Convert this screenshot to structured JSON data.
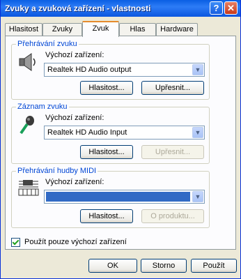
{
  "window": {
    "title": "Zvuky a zvuková zařízení - vlastnosti",
    "help_glyph": "?",
    "close_glyph": "✕"
  },
  "tabs": [
    {
      "label": "Hlasitost"
    },
    {
      "label": "Zvuky"
    },
    {
      "label": "Zvuk",
      "active": true
    },
    {
      "label": "Hlas"
    },
    {
      "label": "Hardware"
    }
  ],
  "playback": {
    "title": "Přehrávání zvuku",
    "device_label": "Výchozí zařízení:",
    "device_value": "Realtek HD Audio output",
    "volume_button": "Hlasitost...",
    "advanced_button": "Upřesnit..."
  },
  "recording": {
    "title": "Záznam zvuku",
    "device_label": "Výchozí zařízení:",
    "device_value": "Realtek HD Audio Input",
    "volume_button": "Hlasitost...",
    "advanced_button": "Upřesnit..."
  },
  "midi": {
    "title": "Přehrávání hudby MIDI",
    "device_label": "Výchozí zařízení:",
    "device_value": "",
    "volume_button": "Hlasitost...",
    "about_button": "O produktu..."
  },
  "default_only": {
    "label": "Použít pouze výchozí zařízení",
    "checked": true
  },
  "footer": {
    "ok": "OK",
    "cancel": "Storno",
    "apply": "Použít"
  },
  "colors": {
    "title_bar": "#0A5FE3",
    "group_title": "#0046D5",
    "selection": "#316AC5",
    "face": "#ECE9D8"
  }
}
